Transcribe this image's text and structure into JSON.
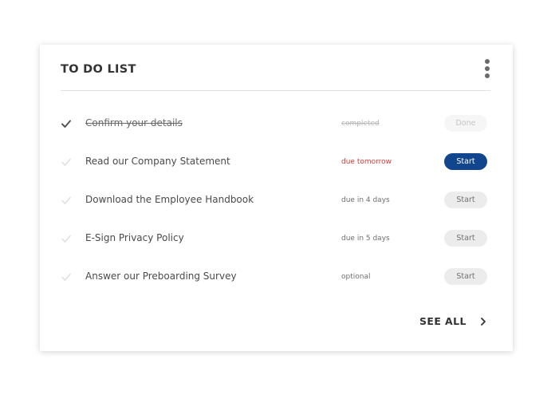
{
  "card": {
    "title": "TO DO LIST",
    "menu_icon": "kebab-menu-icon",
    "see_all_label": "SEE ALL",
    "see_all_icon": "chevron-right-icon"
  },
  "tasks": [
    {
      "label": "Confirm your details",
      "status": "completed",
      "status_state": "done",
      "action": "Done",
      "action_state": "disabled",
      "completed": true
    },
    {
      "label": "Read our Company Statement",
      "status": "due tomorrow",
      "status_state": "urgent",
      "action": "Start",
      "action_state": "primary",
      "completed": false
    },
    {
      "label": "Download the Employee Handbook",
      "status": "due in 4 days",
      "status_state": "normal",
      "action": "Start",
      "action_state": "secondary",
      "completed": false
    },
    {
      "label": "E-Sign Privacy Policy",
      "status": "due in 5 days",
      "status_state": "normal",
      "action": "Start",
      "action_state": "secondary",
      "completed": false
    },
    {
      "label": "Answer our Preboarding Survey",
      "status": "optional",
      "status_state": "normal",
      "action": "Start",
      "action_state": "secondary",
      "completed": false
    }
  ],
  "colors": {
    "primary_button": "#11468f",
    "urgent_text": "#d23b3b",
    "check_done": "#555555",
    "check_pending": "#e0e0e0"
  }
}
